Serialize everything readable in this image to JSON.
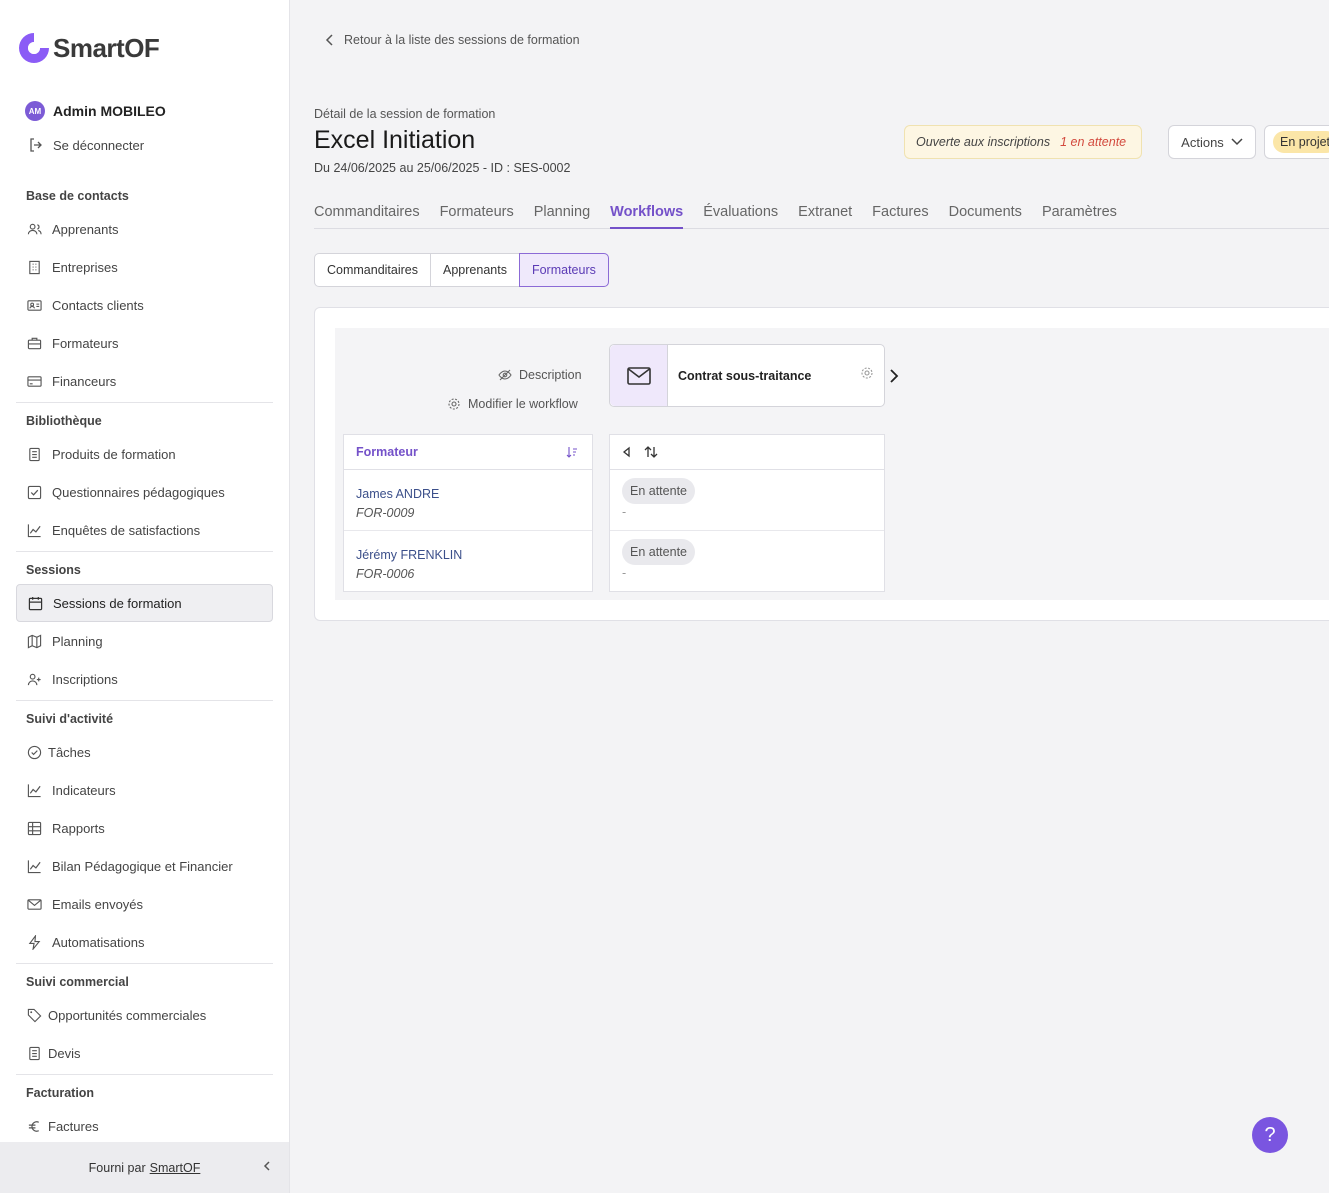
{
  "app": {
    "name": "SmartOF",
    "brand_color": "#7a55e0"
  },
  "user": {
    "initials": "AM",
    "name": "Admin MOBILEO",
    "logout_label": "Se déconnecter"
  },
  "sidebar": {
    "sections": [
      {
        "title": "Base de contacts",
        "items": [
          {
            "label": "Apprenants",
            "icon": "users-icon"
          },
          {
            "label": "Entreprises",
            "icon": "building-icon"
          },
          {
            "label": "Contacts clients",
            "icon": "id-card-icon"
          },
          {
            "label": "Formateurs",
            "icon": "briefcase-icon"
          },
          {
            "label": "Financeurs",
            "icon": "credit-card-icon"
          }
        ]
      },
      {
        "title": "Bibliothèque",
        "items": [
          {
            "label": "Produits de formation",
            "icon": "document-icon"
          },
          {
            "label": "Questionnaires pédagogiques",
            "icon": "checkbox-icon"
          },
          {
            "label": "Enquêtes de satisfactions",
            "icon": "chart-line-icon"
          }
        ]
      },
      {
        "title": "Sessions",
        "items": [
          {
            "label": "Sessions de formation",
            "icon": "calendar-icon",
            "active": true
          },
          {
            "label": "Planning",
            "icon": "map-icon"
          },
          {
            "label": "Inscriptions",
            "icon": "user-plus-icon"
          }
        ]
      },
      {
        "title": "Suivi d'activité",
        "items": [
          {
            "label": "Tâches",
            "icon": "check-circle-icon"
          },
          {
            "label": "Indicateurs",
            "icon": "chart-line-icon"
          },
          {
            "label": "Rapports",
            "icon": "table-icon"
          },
          {
            "label": "Bilan Pédagogique et Financier",
            "icon": "chart-line-icon"
          },
          {
            "label": "Emails envoyés",
            "icon": "mail-icon"
          },
          {
            "label": "Automatisations",
            "icon": "bolt-icon"
          }
        ]
      },
      {
        "title": "Suivi commercial",
        "items": [
          {
            "label": "Opportunités commerciales",
            "icon": "tag-icon"
          },
          {
            "label": "Devis",
            "icon": "document-icon"
          }
        ]
      },
      {
        "title": "Facturation",
        "items": [
          {
            "label": "Factures",
            "icon": "euro-icon"
          }
        ]
      }
    ],
    "footer_prefix": "Fourni par",
    "footer_link": "SmartOF"
  },
  "page": {
    "back_label": "Retour à la liste des sessions de formation",
    "subtitle": "Détail de la session de formation",
    "title": "Excel Initiation",
    "dates": "Du 24/06/2025 au 25/06/2025 - ID : SES-0002",
    "status": "Ouverte aux inscriptions",
    "pending": "1 en attente",
    "actions_label": "Actions",
    "project_status": "En projet"
  },
  "tabs": [
    "Commanditaires",
    "Formateurs",
    "Planning",
    "Workflows",
    "Évaluations",
    "Extranet",
    "Factures",
    "Documents",
    "Paramètres"
  ],
  "active_tab": "Workflows",
  "segments": [
    "Commanditaires",
    "Apprenants",
    "Formateurs"
  ],
  "active_segment": "Formateurs",
  "workflow": {
    "description_label": "Description",
    "modify_label": "Modifier le workflow",
    "step_name": "Contrat sous-traitance",
    "column_header": "Formateur",
    "rows": [
      {
        "name": "James ANDRE",
        "code": "FOR-0009",
        "status": "En attente",
        "detail": "-"
      },
      {
        "name": "Jérémy FRENKLIN",
        "code": "FOR-0006",
        "status": "En attente",
        "detail": "-"
      }
    ]
  },
  "help_label": "?"
}
